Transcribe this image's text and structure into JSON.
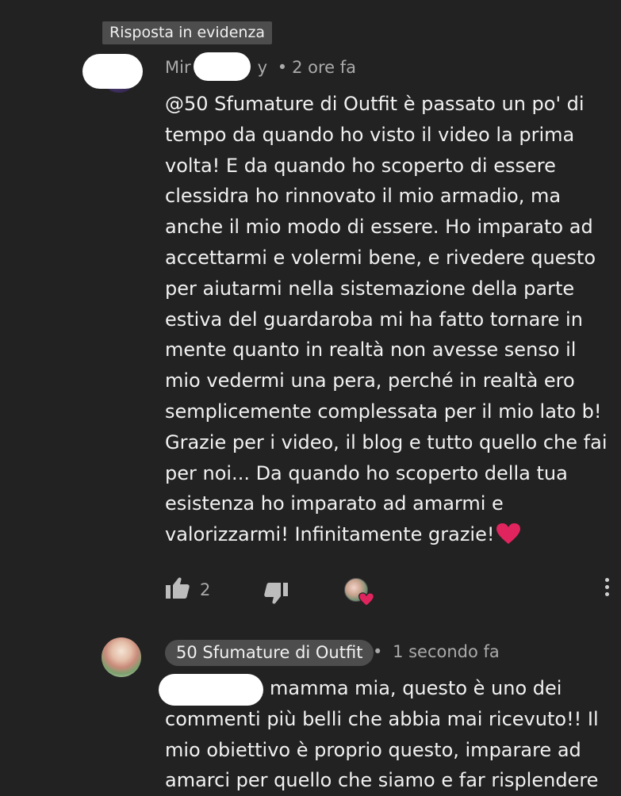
{
  "highlighted_label": "Risposta in evidenza",
  "comment": {
    "author_visible_start": "Mir",
    "author_visible_end": "y",
    "time": "2 ore fa",
    "lines": [
      "@50 Sfumature di Outfit è passato un po' di",
      "tempo da quando ho visto il video la prima",
      "volta! E da quando ho scoperto di essere",
      "clessidra ho rinnovato il mio armadio, ma",
      "anche il mio modo di essere. Ho imparato ad",
      "accettarmi e volermi bene, e rivedere questo",
      "per aiutarmi nella sistemazione della parte",
      "estiva del guardaroba mi ha fatto tornare in",
      "mente quanto in realtà non avesse senso il",
      "mio vedermi una pera, perché in realtà ero",
      "semplicemente complessata per il mio lato b!",
      "Grazie per i video, il blog e tutto quello che fai",
      "per noi... Da quando ho scoperto della tua",
      "esistenza ho imparato ad amarmi e",
      "valorizzarmi! Infinitamente grazie!"
    ],
    "likes": "2",
    "colors": {
      "heart": "#e0245e"
    }
  },
  "reply": {
    "author": "50 Sfumature di Outfit",
    "time": "1 secondo fa",
    "lines": [
      "mamma mia, questo è uno dei",
      "commenti più belli che abbia mai ricevuto!! Il",
      "mio obiettivo è proprio questo, imparare ad",
      "amarci per quello che siamo e far risplendere"
    ]
  },
  "separator": "•",
  "icons": {
    "like": "thumbs-up-icon",
    "dislike": "thumbs-down-icon",
    "creator_heart": "creator-heart-icon",
    "more": "more-vertical-icon"
  },
  "theme": {
    "background": "#222222",
    "text": "#f1f1f1",
    "secondary_text": "#aaaaaa",
    "chip": "#4d4d4d"
  }
}
